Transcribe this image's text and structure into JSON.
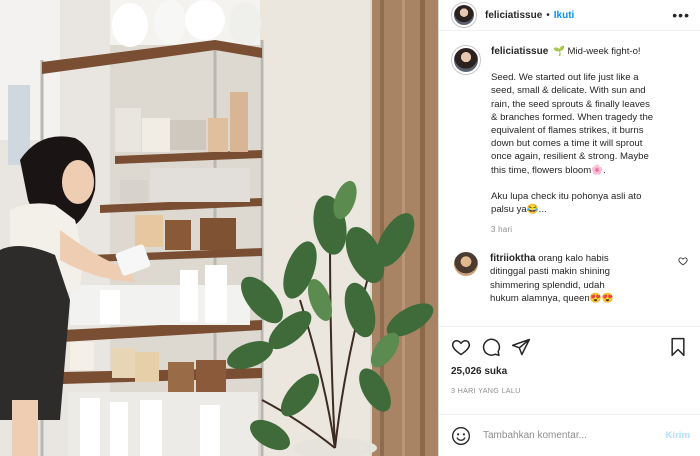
{
  "header": {
    "username": "feliciatissue",
    "separator": "•",
    "follow_label": "Ikuti",
    "more_icon": "more-horizontal-icon"
  },
  "caption": {
    "username": "feliciatissue",
    "first_line": "🌱 Mid-week fight-o!",
    "paragraph1": [
      "Seed. We started out life just like a",
      "seed, small & delicate. With sun and",
      "rain, the seed sprouts & finally leaves",
      "& branches formed. When tragedy the",
      "equivalent of flames strikes, it burns",
      "down but comes a time it will sprout",
      "once again, resilient & strong. Maybe",
      "this time, flowers bloom🌸."
    ],
    "paragraph2": [
      "Aku lupa check itu pohonya asli ato",
      "palsu ya😂..."
    ],
    "time": "3 hari"
  },
  "comment": {
    "username": "fitriioktha",
    "lines": [
      "orang kalo habis",
      "ditinggal pasti makin shining",
      "shimmering splendid, udah",
      "hukum alamnya, queen😍😍"
    ]
  },
  "actions": {
    "icons": [
      "heart-icon",
      "comment-icon",
      "share-icon",
      "bookmark-icon"
    ],
    "likes": "25,026 suka",
    "posted_ago": "3 HARI YANG LALU"
  },
  "add_comment": {
    "placeholder": "Tambahkan komentar...",
    "send_label": "Kirim"
  },
  "colors": {
    "link_blue": "#0095f6",
    "muted": "#8e8e8e",
    "send_disabled": "#b2dffc"
  }
}
